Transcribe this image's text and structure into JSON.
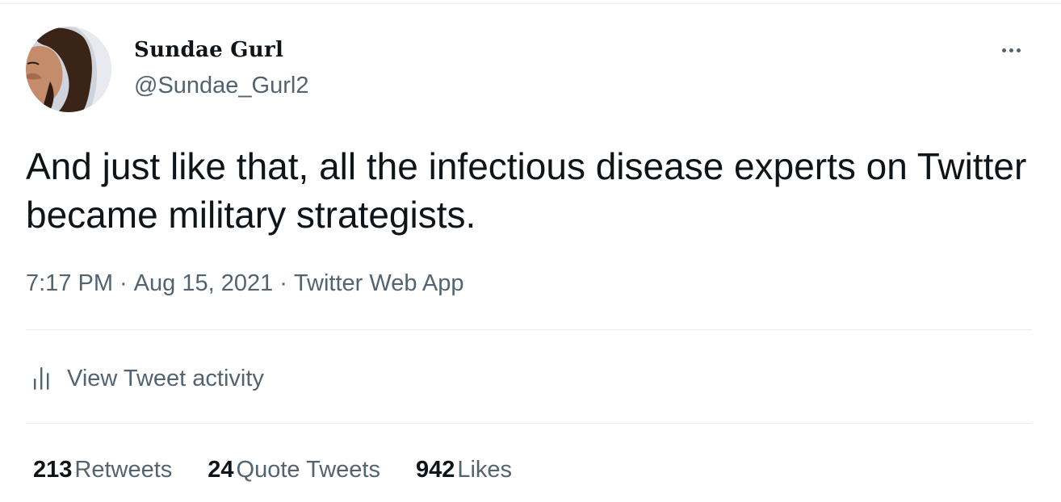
{
  "author": {
    "display_name": "Sundae Gurl",
    "handle": "@Sundae_Gurl2"
  },
  "tweet": {
    "text": "And just like that, all the infectious disease experts on Twitter became military strategists.",
    "time": "7:17 PM",
    "date": "Aug 15, 2021",
    "separator": "·",
    "source": "Twitter Web App"
  },
  "activity": {
    "label": "View Tweet activity",
    "icon": "bar-chart-icon"
  },
  "menu": {
    "icon": "more-options-icon"
  },
  "stats": [
    {
      "count": "213",
      "label": "Retweets"
    },
    {
      "count": "24",
      "label": "Quote Tweets"
    },
    {
      "count": "942",
      "label": "Likes"
    }
  ],
  "colors": {
    "primary_text": "#0f1419",
    "secondary_text": "#536471",
    "divider": "#e6ecf0"
  }
}
